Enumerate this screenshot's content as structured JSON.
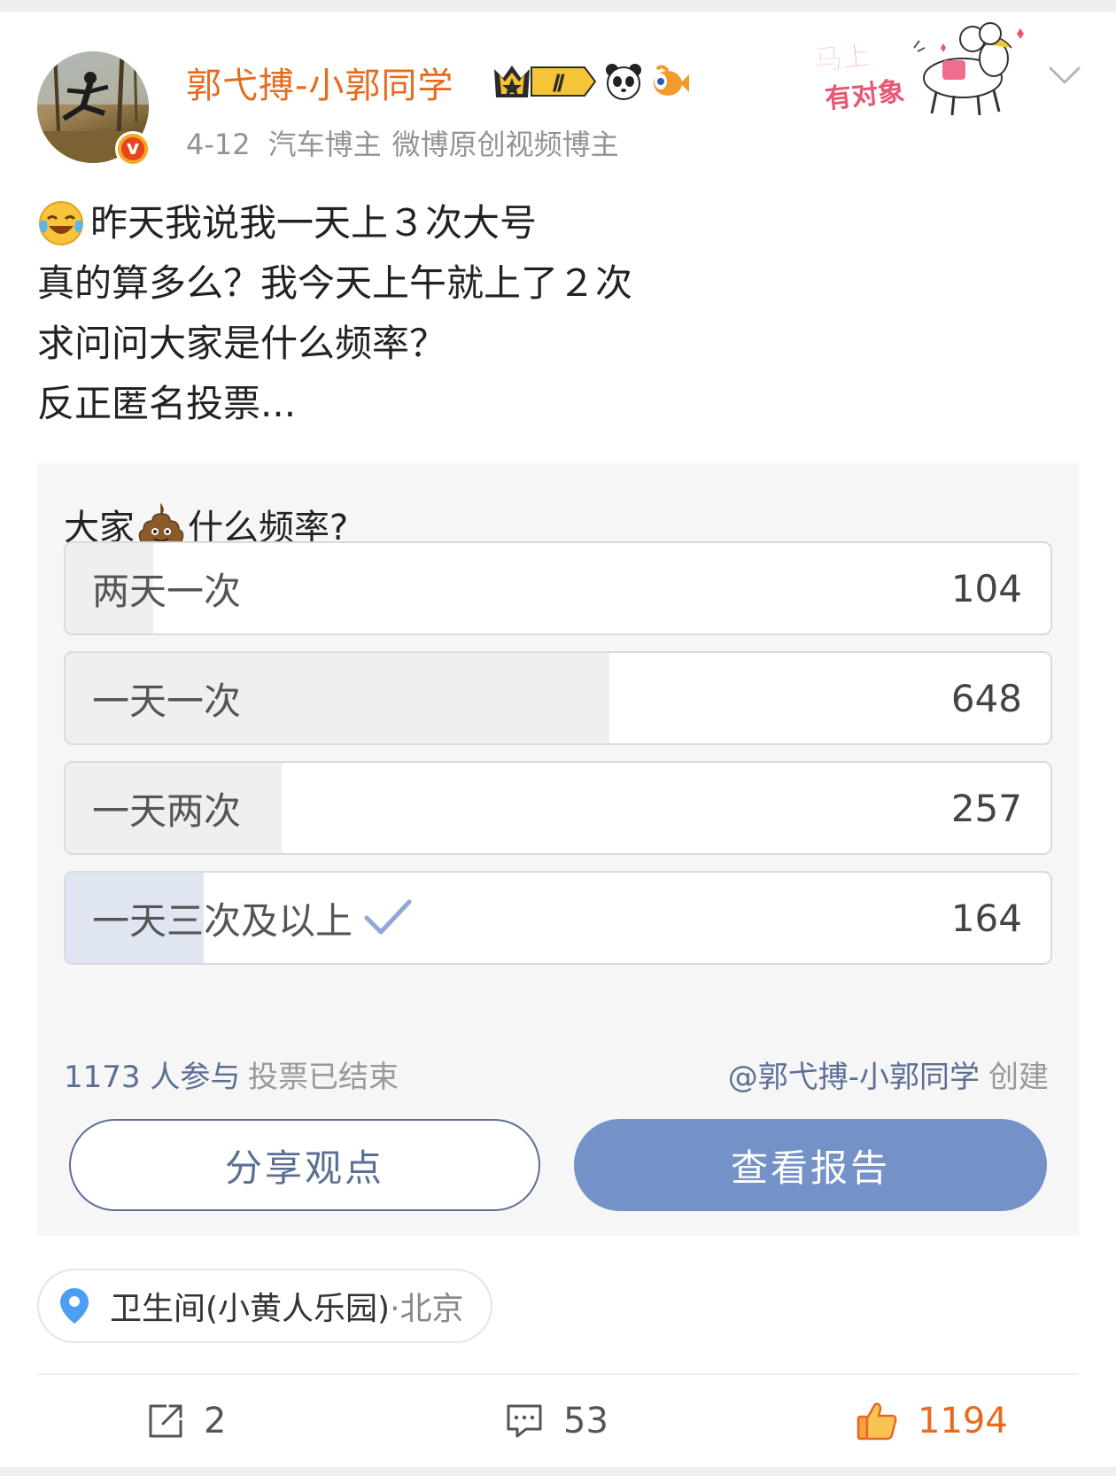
{
  "post": {
    "username": "郭弋搏-小郭同学",
    "level_badge": "Ⅱ",
    "date": "4-12",
    "tag_1": "汽车博主",
    "tag_2": "微博原创视频博主",
    "sticker_text_1": "马上",
    "sticker_text_2": "有对象",
    "lines": [
      "昨天我说我一天上３次大号",
      "真的算多么？我今天上午就上了２次",
      "求问问大家是什么频率？",
      "反正匿名投票..."
    ]
  },
  "poll": {
    "title_prefix": "大家",
    "title_suffix": "什么频率?",
    "options": [
      {
        "label": "两天一次",
        "count": "104",
        "fraction": 0.089,
        "voted": false
      },
      {
        "label": "一天一次",
        "count": "648",
        "fraction": 0.552,
        "voted": false
      },
      {
        "label": "一天两次",
        "count": "257",
        "fraction": 0.219,
        "voted": false
      },
      {
        "label": "一天三次及以上",
        "count": "164",
        "fraction": 0.14,
        "voted": true
      }
    ],
    "participants": "1173 人参与",
    "status": "投票已结束",
    "creator_handle": "@郭弋搏-小郭同学",
    "creator_suffix": "创建",
    "share_label": "分享观点",
    "report_label": "查看报告"
  },
  "location": {
    "place": "卫生间(小黄人乐园)",
    "city": "·北京"
  },
  "actions": {
    "reposts": "2",
    "comments": "53",
    "likes": "1194"
  },
  "colors": {
    "username": "#e86b1c",
    "poll_link": "#5b6f95",
    "report_button": "#7492c8",
    "like": "#e86b1c",
    "verified_badge": "#f5a623"
  },
  "icons": [
    "chevron-down-icon",
    "verified-icon",
    "crown-badge-icon",
    "panda-icon",
    "fish-icon",
    "laugh-cry-icon",
    "poop-icon",
    "check-icon",
    "location-pin-icon",
    "repost-icon",
    "comment-icon",
    "like-icon"
  ]
}
